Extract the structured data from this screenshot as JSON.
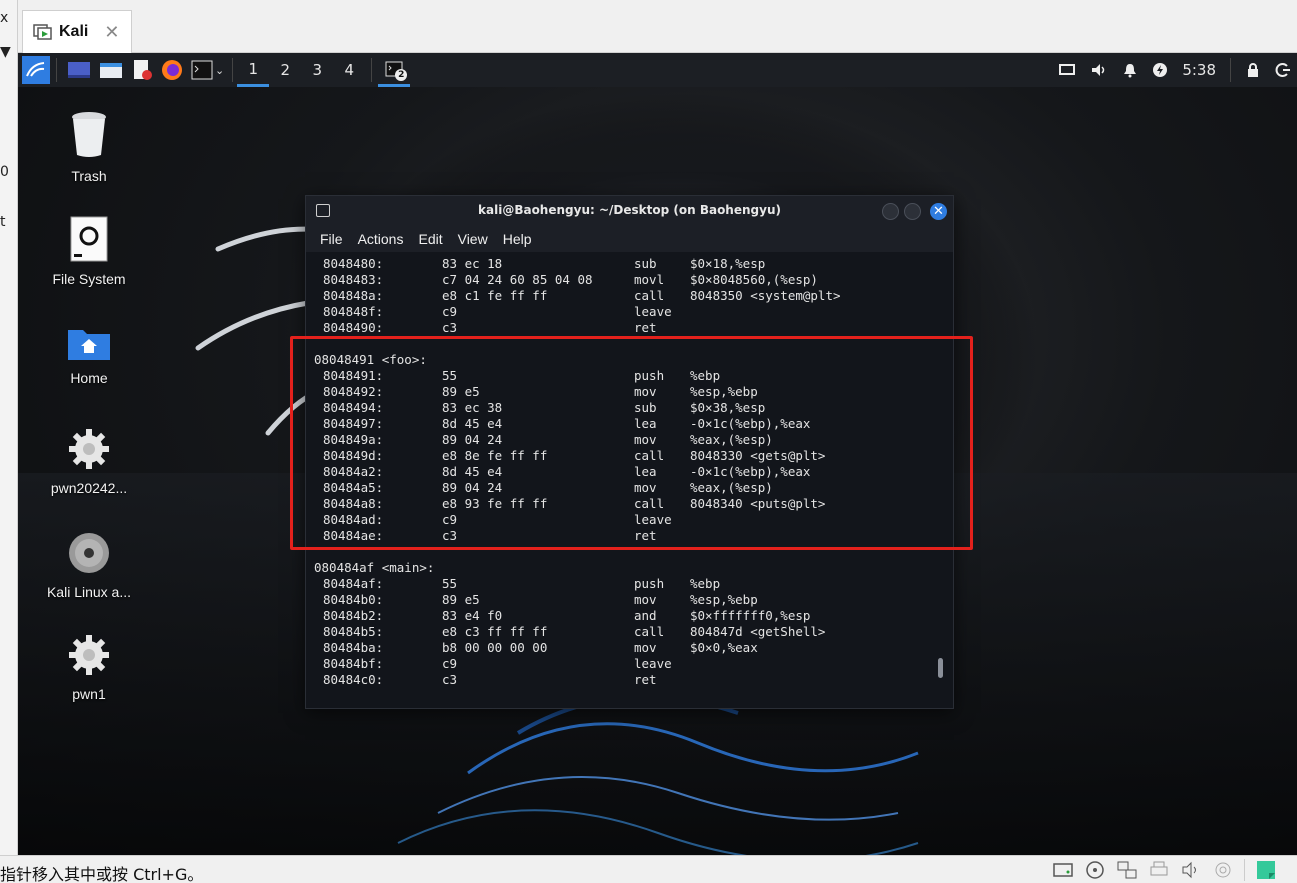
{
  "vm": {
    "tab_label": "Kali",
    "tab_close": "✕",
    "status_hint": "指针移入其中或按 Ctrl+G。",
    "left_fragments": [
      "x",
      "0",
      "t"
    ]
  },
  "panel": {
    "workspaces": [
      "1",
      "2",
      "3",
      "4"
    ],
    "active_workspace": "1",
    "terminal_badge": "2",
    "clock": "5:38"
  },
  "desktop_icons": [
    {
      "label": "Trash",
      "icon": "trash-icon"
    },
    {
      "label": "File System",
      "icon": "drive-icon"
    },
    {
      "label": "Home",
      "icon": "home-folder-icon"
    },
    {
      "label": "pwn20242...",
      "icon": "gear-icon"
    },
    {
      "label": "Kali Linux a...",
      "icon": "disc-icon"
    },
    {
      "label": "pwn1",
      "icon": "gear-icon"
    }
  ],
  "terminal": {
    "title": "kali@Baohengyu: ~/Desktop (on Baohengyu)",
    "menu": [
      "File",
      "Actions",
      "Edit",
      "View",
      "Help"
    ],
    "close_glyph": "✕",
    "pre_lines": [
      {
        "addr": "8048480:",
        "bytes": "83 ec 18",
        "mn": "sub",
        "op": "$0×18,%esp"
      },
      {
        "addr": "8048483:",
        "bytes": "c7 04 24 60 85 04 08",
        "mn": "movl",
        "op": "$0×8048560,(%esp)"
      },
      {
        "addr": "804848a:",
        "bytes": "e8 c1 fe ff ff",
        "mn": "call",
        "op": "8048350 <system@plt>"
      },
      {
        "addr": "804848f:",
        "bytes": "c9",
        "mn": "leave",
        "op": ""
      },
      {
        "addr": "8048490:",
        "bytes": "c3",
        "mn": "ret",
        "op": ""
      }
    ],
    "foo_header": "08048491 <foo>:",
    "foo_lines": [
      {
        "addr": "8048491:",
        "bytes": "55",
        "mn": "push",
        "op": "%ebp"
      },
      {
        "addr": "8048492:",
        "bytes": "89 e5",
        "mn": "mov",
        "op": "%esp,%ebp"
      },
      {
        "addr": "8048494:",
        "bytes": "83 ec 38",
        "mn": "sub",
        "op": "$0×38,%esp"
      },
      {
        "addr": "8048497:",
        "bytes": "8d 45 e4",
        "mn": "lea",
        "op": "-0×1c(%ebp),%eax"
      },
      {
        "addr": "804849a:",
        "bytes": "89 04 24",
        "mn": "mov",
        "op": "%eax,(%esp)"
      },
      {
        "addr": "804849d:",
        "bytes": "e8 8e fe ff ff",
        "mn": "call",
        "op": "8048330 <gets@plt>"
      },
      {
        "addr": "80484a2:",
        "bytes": "8d 45 e4",
        "mn": "lea",
        "op": "-0×1c(%ebp),%eax"
      },
      {
        "addr": "80484a5:",
        "bytes": "89 04 24",
        "mn": "mov",
        "op": "%eax,(%esp)"
      },
      {
        "addr": "80484a8:",
        "bytes": "e8 93 fe ff ff",
        "mn": "call",
        "op": "8048340 <puts@plt>"
      },
      {
        "addr": "80484ad:",
        "bytes": "c9",
        "mn": "leave",
        "op": ""
      },
      {
        "addr": "80484ae:",
        "bytes": "c3",
        "mn": "ret",
        "op": ""
      }
    ],
    "main_header": "080484af <main>:",
    "main_lines": [
      {
        "addr": "80484af:",
        "bytes": "55",
        "mn": "push",
        "op": "%ebp"
      },
      {
        "addr": "80484b0:",
        "bytes": "89 e5",
        "mn": "mov",
        "op": "%esp,%ebp"
      },
      {
        "addr": "80484b2:",
        "bytes": "83 e4 f0",
        "mn": "and",
        "op": "$0×fffffff0,%esp"
      },
      {
        "addr": "80484b5:",
        "bytes": "e8 c3 ff ff ff",
        "mn": "call",
        "op": "804847d <getShell>"
      },
      {
        "addr": "80484ba:",
        "bytes": "b8 00 00 00 00",
        "mn": "mov",
        "op": "$0×0,%eax"
      },
      {
        "addr": "80484bf:",
        "bytes": "c9",
        "mn": "leave",
        "op": ""
      },
      {
        "addr": "80484c0:",
        "bytes": "c3",
        "mn": "ret",
        "op": ""
      }
    ]
  },
  "colors": {
    "highlight_box": "#e3211c",
    "accent": "#2f7de1"
  }
}
